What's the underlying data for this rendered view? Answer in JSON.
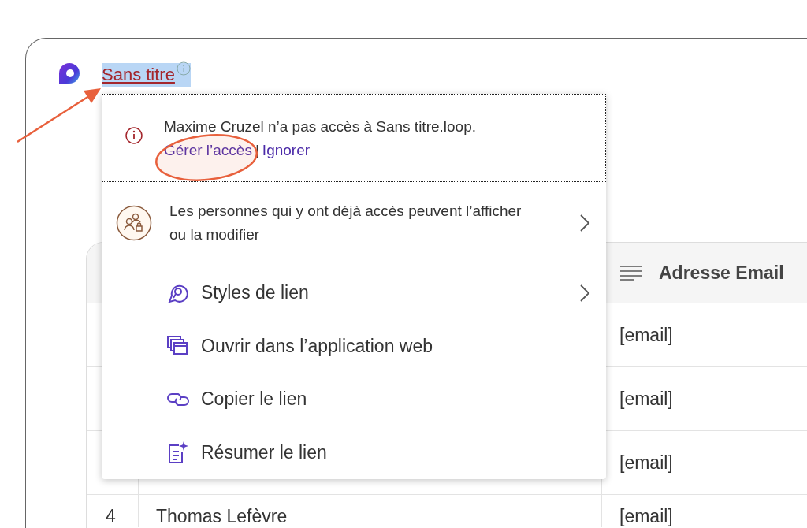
{
  "document": {
    "title": "Sans titre",
    "title_selected": true
  },
  "popup": {
    "notice": {
      "message": "Maxime Cruzel n’a pas accès à Sans titre.loop.",
      "actions": [
        "Gérer l’accès",
        "Ignorer"
      ],
      "separator": "|"
    },
    "permission": {
      "text": "Les personnes qui y ont déjà accès peuvent l’afficher ou la modifier",
      "has_submenu": true
    },
    "items": [
      {
        "kind": "styles",
        "label": "Styles de lien",
        "has_submenu": true
      },
      {
        "kind": "open",
        "label": "Ouvrir dans l’application web",
        "has_submenu": false
      },
      {
        "kind": "copy",
        "label": "Copier le lien",
        "has_submenu": false
      },
      {
        "kind": "summary",
        "label": "Résumer le lien",
        "has_submenu": false
      }
    ]
  },
  "table": {
    "email_column": {
      "label": "Adresse Email"
    },
    "rows": [
      {
        "email": "[email]"
      },
      {
        "email": "[email]"
      },
      {
        "email": "[email]"
      },
      {
        "number": "4",
        "name": "Thomas Lefèvre",
        "email": "[email]"
      }
    ]
  }
}
